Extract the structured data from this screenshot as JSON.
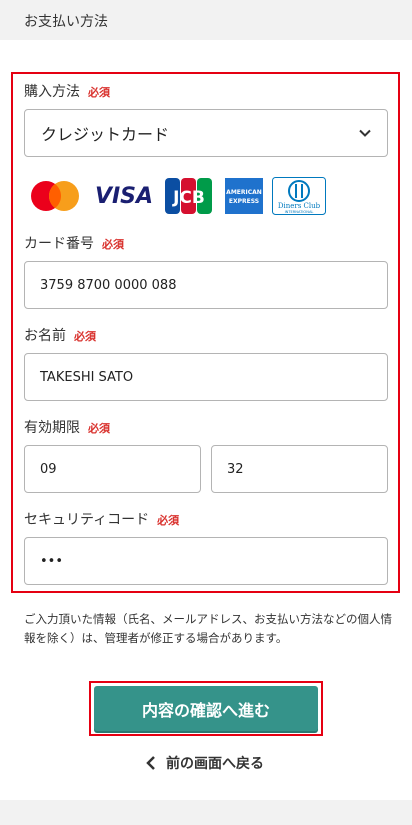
{
  "section_title": "お支払い方法",
  "purchase_method": {
    "label": "購入方法",
    "required": "必須",
    "selected": "クレジットカード"
  },
  "card_brands": [
    "mastercard-logo",
    "visa-logo",
    "jcb-logo",
    "amex-logo",
    "diners-club-logo"
  ],
  "brand_text": {
    "visa": "VISA",
    "jcb": "JCB",
    "amex_top": "AMERICAN",
    "amex_bottom": "EXPRESS",
    "diners_top": "Diners Club",
    "diners_bottom": "INTERNATIONAL"
  },
  "card_number": {
    "label": "カード番号",
    "required": "必須",
    "value": "3759 8700 0000 088"
  },
  "name": {
    "label": "お名前",
    "required": "必須",
    "value": "TAKESHI SATO"
  },
  "expiry": {
    "label": "有効期限",
    "required": "必須",
    "month": "09",
    "year": "32"
  },
  "security_code": {
    "label": "セキュリティコード",
    "required": "必須",
    "value": "•••"
  },
  "notice": "ご入力頂いた情報（氏名、メールアドレス、お支払い方法などの個人情報を除く）は、管理者が修正する場合があります。",
  "submit_label": "内容の確認へ進む",
  "back_label": "前の画面へ戻る",
  "colors": {
    "accent": "#35938a",
    "required": "#d9302c",
    "highlight": "#e50012"
  }
}
